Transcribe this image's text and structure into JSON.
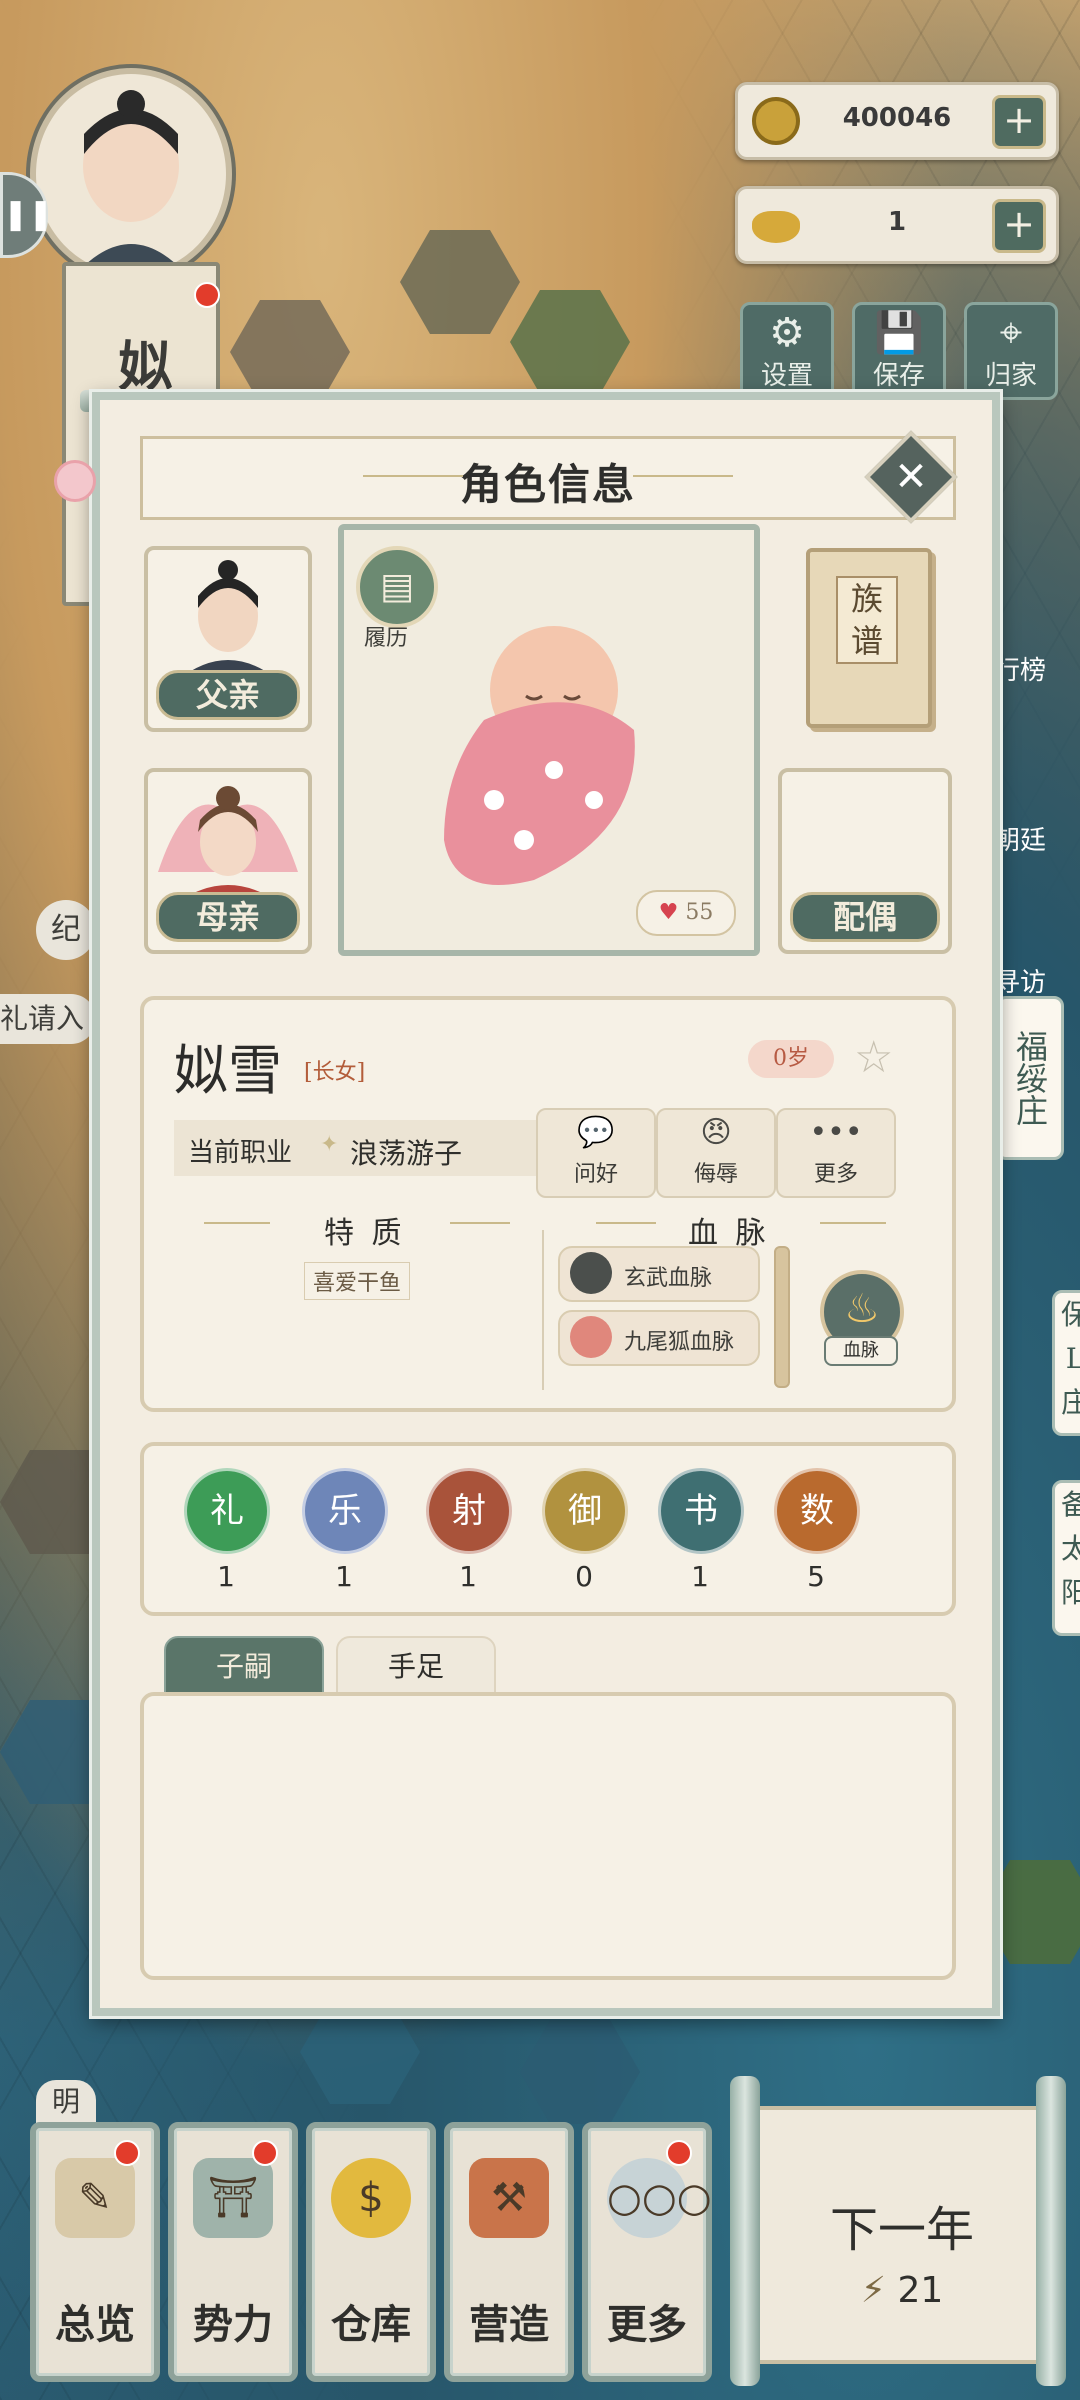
{
  "hud": {
    "coins": "400046",
    "ingots": "1",
    "buttons": [
      {
        "label": "设置",
        "icon": "gear-icon"
      },
      {
        "label": "保存",
        "icon": "save-icon"
      },
      {
        "label": "归家",
        "icon": "location-pin-icon"
      }
    ],
    "side_labels": [
      "行榜",
      "朝廷",
      "寻访"
    ],
    "fuzhuang": "福绥庄",
    "partial_right_1": "保\nL\n庄",
    "partial_right_2": "备\n太\n阳",
    "left_partial_a": "纪",
    "left_partial_b": "礼请入",
    "left_partial_c": "明"
  },
  "player": {
    "name_vertical": "姒乐",
    "name_partial": "姒\n乐"
  },
  "modal": {
    "title": "角色信息",
    "close": "✕",
    "father_label": "父亲",
    "mother_label": "母亲",
    "spouse_label": "配偶",
    "resume_label": "履历",
    "resume_icon": "scroll-icon",
    "heart_value": "55",
    "genealogy_label": "族\n谱",
    "character": {
      "name": "姒雪",
      "rank": "[长女]",
      "age": "0岁",
      "job_label": "当前职业",
      "job_value": "浪荡游子"
    },
    "actions": [
      {
        "label": "问好",
        "glyph": "💬"
      },
      {
        "label": "侮辱",
        "glyph": "😠"
      },
      {
        "label": "更多",
        "glyph": "•••"
      }
    ],
    "traits_header": "特 质",
    "bloodline_header": "血 脉",
    "traits": [
      "喜爱干鱼"
    ],
    "bloodlines": [
      {
        "label": "玄武血脉",
        "color": "#4b4f4c"
      },
      {
        "label": "九尾狐血脉",
        "color": "#e0877c"
      }
    ],
    "bloodline_button": "血脉",
    "skills": [
      {
        "name": "礼",
        "value": "1",
        "color": "#3d9c57"
      },
      {
        "name": "乐",
        "value": "1",
        "color": "#6e86b8"
      },
      {
        "name": "射",
        "value": "1",
        "color": "#a9533a"
      },
      {
        "name": "御",
        "value": "0",
        "color": "#b1923f"
      },
      {
        "name": "书",
        "value": "1",
        "color": "#3f6f72"
      },
      {
        "name": "数",
        "value": "5",
        "color": "#b96a2e"
      }
    ],
    "tabs": [
      "子嗣",
      "手足"
    ]
  },
  "bottom_nav": [
    {
      "label": "总览",
      "icon": "brush-scroll-icon",
      "badge": true
    },
    {
      "label": "势力",
      "icon": "palace-icon",
      "badge": true
    },
    {
      "label": "仓库",
      "icon": "money-bag-icon",
      "badge": false
    },
    {
      "label": "营造",
      "icon": "trowel-brick-icon",
      "badge": false
    },
    {
      "label": "更多",
      "icon": "more-dots-icon",
      "badge": true
    }
  ],
  "next_year": {
    "label": "下一年",
    "energy": "21"
  }
}
